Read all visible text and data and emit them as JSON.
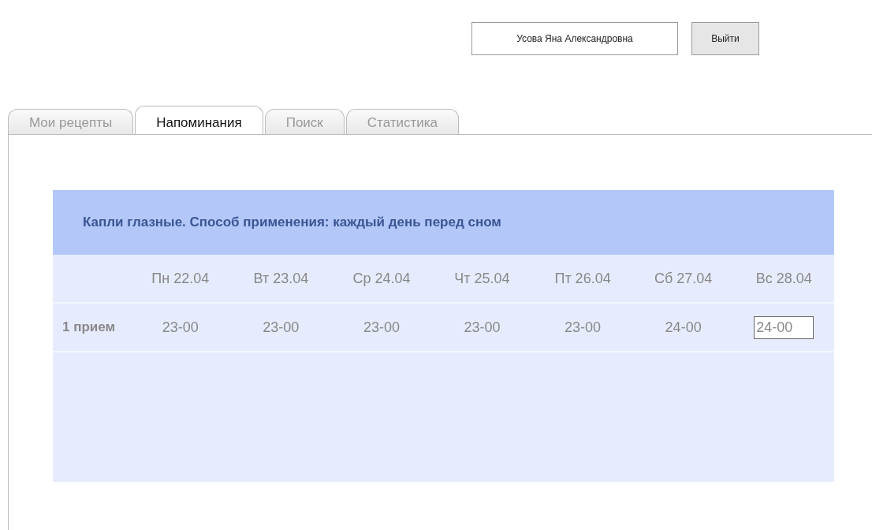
{
  "user": {
    "name": "Усова Яна Александровна"
  },
  "logout_button": "Выйти",
  "tabs": [
    {
      "label": "Мои рецепты",
      "selected": false
    },
    {
      "label": "Напоминания",
      "selected": true
    },
    {
      "label": "Поиск",
      "selected": false
    },
    {
      "label": "Статистика",
      "selected": false
    }
  ],
  "reminder": {
    "title": "Капли глазные. Способ применения: каждый день перед сном",
    "days": [
      "Пн 22.04",
      "Вт 23.04",
      "Ср 24.04",
      "Чт 25.04",
      "Пт 26.04",
      "Сб 27.04",
      "Вс 28.04"
    ],
    "rows": [
      {
        "label": "1 прием",
        "times": [
          {
            "value": "23-00",
            "editing": false
          },
          {
            "value": "23-00",
            "editing": false
          },
          {
            "value": "23-00",
            "editing": false
          },
          {
            "value": "23-00",
            "editing": false
          },
          {
            "value": "23-00",
            "editing": false
          },
          {
            "value": "24-00",
            "editing": false
          },
          {
            "value": "24-00",
            "editing": true
          }
        ]
      }
    ]
  }
}
